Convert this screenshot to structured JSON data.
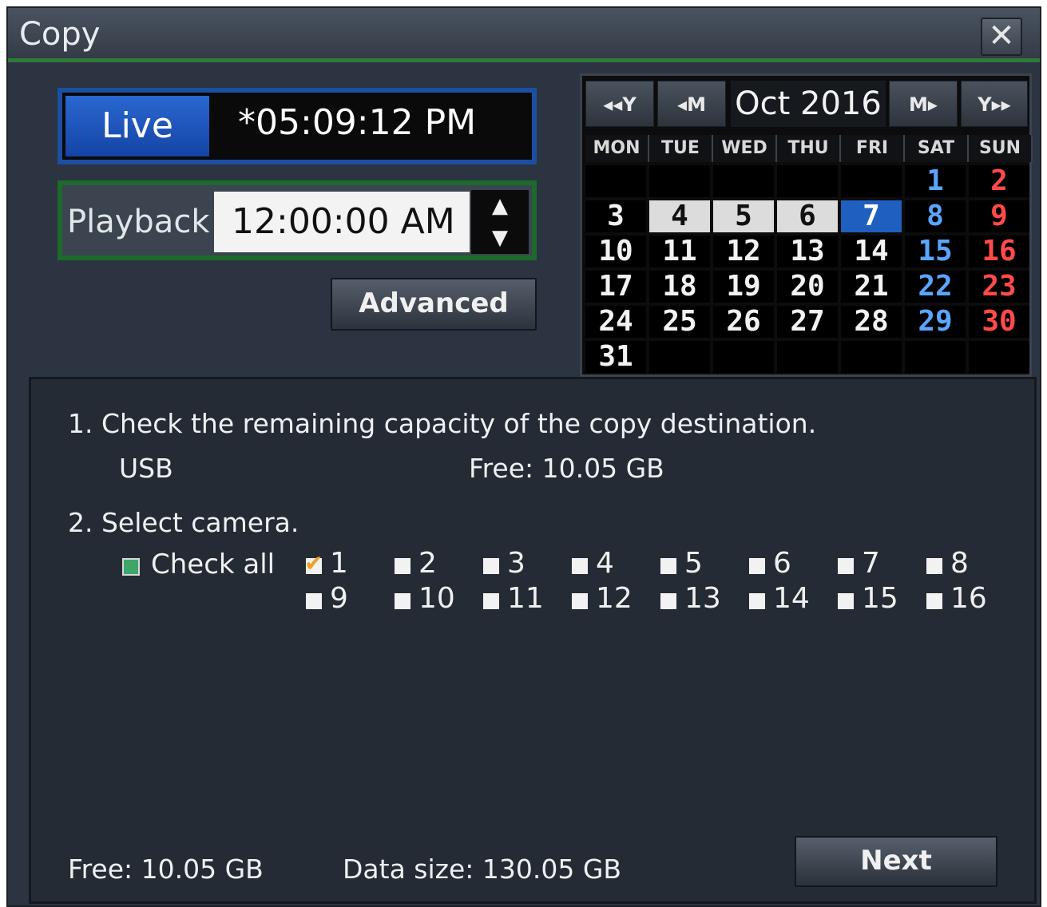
{
  "window": {
    "title": "Copy",
    "close_glyph": "✕"
  },
  "live": {
    "label": "Live",
    "time": "*05:09:12 PM"
  },
  "playback": {
    "label": "Playback",
    "time": "12:00:00 AM",
    "spin_up_glyph": "▲",
    "spin_down_glyph": "▼"
  },
  "advanced_button": "Advanced",
  "calendar": {
    "month_label": "Oct 2016",
    "nav": {
      "prev_year": "◂◂Y",
      "prev_month": "◂M",
      "next_month": "M▸",
      "next_year": "Y▸▸"
    },
    "weekdays": [
      "MON",
      "TUE",
      "WED",
      "THU",
      "FRI",
      "SAT",
      "SUN"
    ],
    "weeks": [
      [
        "",
        "",
        "",
        "",
        "",
        "1",
        "2"
      ],
      [
        "3",
        "4",
        "5",
        "6",
        "7",
        "8",
        "9"
      ],
      [
        "10",
        "11",
        "12",
        "13",
        "14",
        "15",
        "16"
      ],
      [
        "17",
        "18",
        "19",
        "20",
        "21",
        "22",
        "23"
      ],
      [
        "24",
        "25",
        "26",
        "27",
        "28",
        "29",
        "30"
      ],
      [
        "31",
        "",
        "",
        "",
        "",
        "",
        ""
      ]
    ],
    "selected_day": "7",
    "recorded_days": [
      "4",
      "5",
      "6"
    ],
    "colors": {
      "saturday": "#5aa6ff",
      "sunday": "#ff4a4a",
      "selected_bg": "#1f5fbf",
      "recorded_bg": "#dcdcdc"
    }
  },
  "step1": {
    "heading": "1. Check the remaining capacity of the copy destination.",
    "device": "USB",
    "free": "Free: 10.05 GB"
  },
  "step2": {
    "heading": "2. Select camera.",
    "check_all": "Check all",
    "cameras": [
      "1",
      "2",
      "3",
      "4",
      "5",
      "6",
      "7",
      "8",
      "9",
      "10",
      "11",
      "12",
      "13",
      "14",
      "15",
      "16"
    ],
    "checked_cameras": [
      "1"
    ],
    "check_all_color": "#3fa66a",
    "checked_color": "#f0a020"
  },
  "footer": {
    "free": "Free: 10.05 GB",
    "data_size": "Data size: 130.05 GB",
    "next_button": "Next"
  }
}
